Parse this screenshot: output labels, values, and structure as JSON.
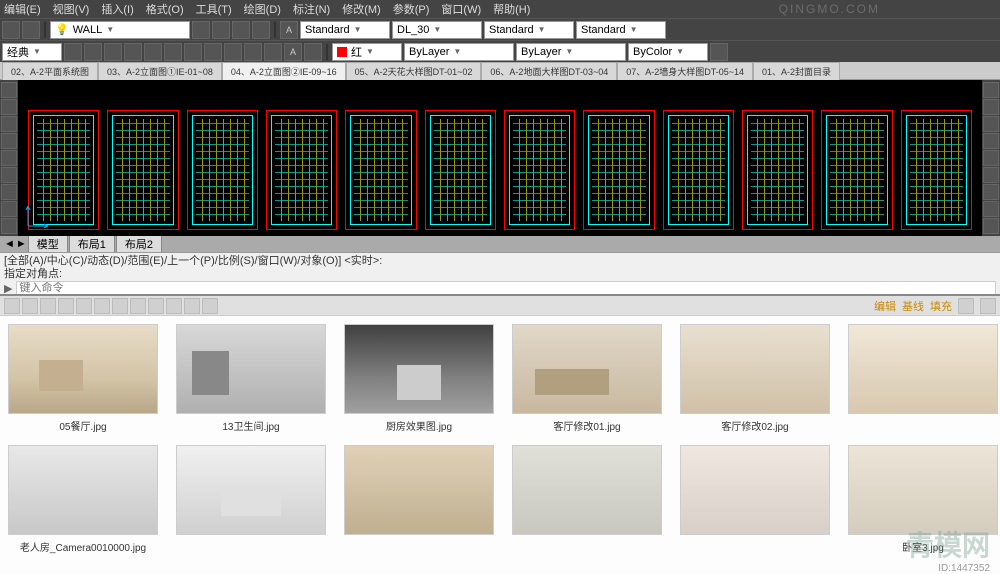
{
  "menu": [
    "编辑(E)",
    "视图(V)",
    "插入(I)",
    "格式(O)",
    "工具(T)",
    "绘图(D)",
    "标注(N)",
    "修改(M)",
    "参数(P)",
    "窗口(W)",
    "帮助(H)"
  ],
  "toolbar1": {
    "layer_label": "WALL",
    "standard": "Standard",
    "dim": "DL_30",
    "standard2": "Standard",
    "standard3": "Standard"
  },
  "toolbar2": {
    "classic": "经典",
    "color_label": "红",
    "bylayer1": "ByLayer",
    "bylayer2": "ByLayer",
    "bycolor": "ByColor"
  },
  "file_tabs": [
    "02、A-2平面系统图",
    "03、A-2立面图①IE-01~08",
    "04、A-2立面图②IE-09~16",
    "05、A-2天花大样图DT-01~02",
    "06、A-2地面大样图DT-03~04",
    "07、A-2墙身大样图DT-05~14",
    "01、A-2封面目录"
  ],
  "active_tab_index": 2,
  "layout_tabs": [
    "模型",
    "布局1",
    "布局2"
  ],
  "cmd": {
    "line1": "[全部(A)/中心(C)/动态(D)/范围(E)/上一个(P)/比例(S)/窗口(W)/对象(O)] <实时>:",
    "line2": "指定对角点:",
    "prompt": "键入命令",
    "prompt_icon": "▶"
  },
  "browser": {
    "right_labels": [
      "编辑",
      "基线",
      "填充"
    ],
    "watermark": "青模网",
    "watermark_top": "QINGMO.COM",
    "id": "ID:1447352",
    "row1": [
      {
        "label": "05餐厅.jpg",
        "cls": "r1"
      },
      {
        "label": "13卫生间.jpg",
        "cls": "r2"
      },
      {
        "label": "厨房效果图.jpg",
        "cls": "r3"
      },
      {
        "label": "客厅修改01.jpg",
        "cls": "r4"
      },
      {
        "label": "客厅修改02.jpg",
        "cls": "r5"
      },
      {
        "label": "",
        "cls": "r6"
      }
    ],
    "row2": [
      {
        "label": "老人房_Camera0010000.jpg",
        "cls": "r7"
      },
      {
        "label": "",
        "cls": "r8"
      },
      {
        "label": "",
        "cls": "r9"
      },
      {
        "label": "",
        "cls": "r10"
      },
      {
        "label": "",
        "cls": "r11"
      },
      {
        "label": "卧室3.jpg",
        "cls": "r12"
      }
    ]
  }
}
